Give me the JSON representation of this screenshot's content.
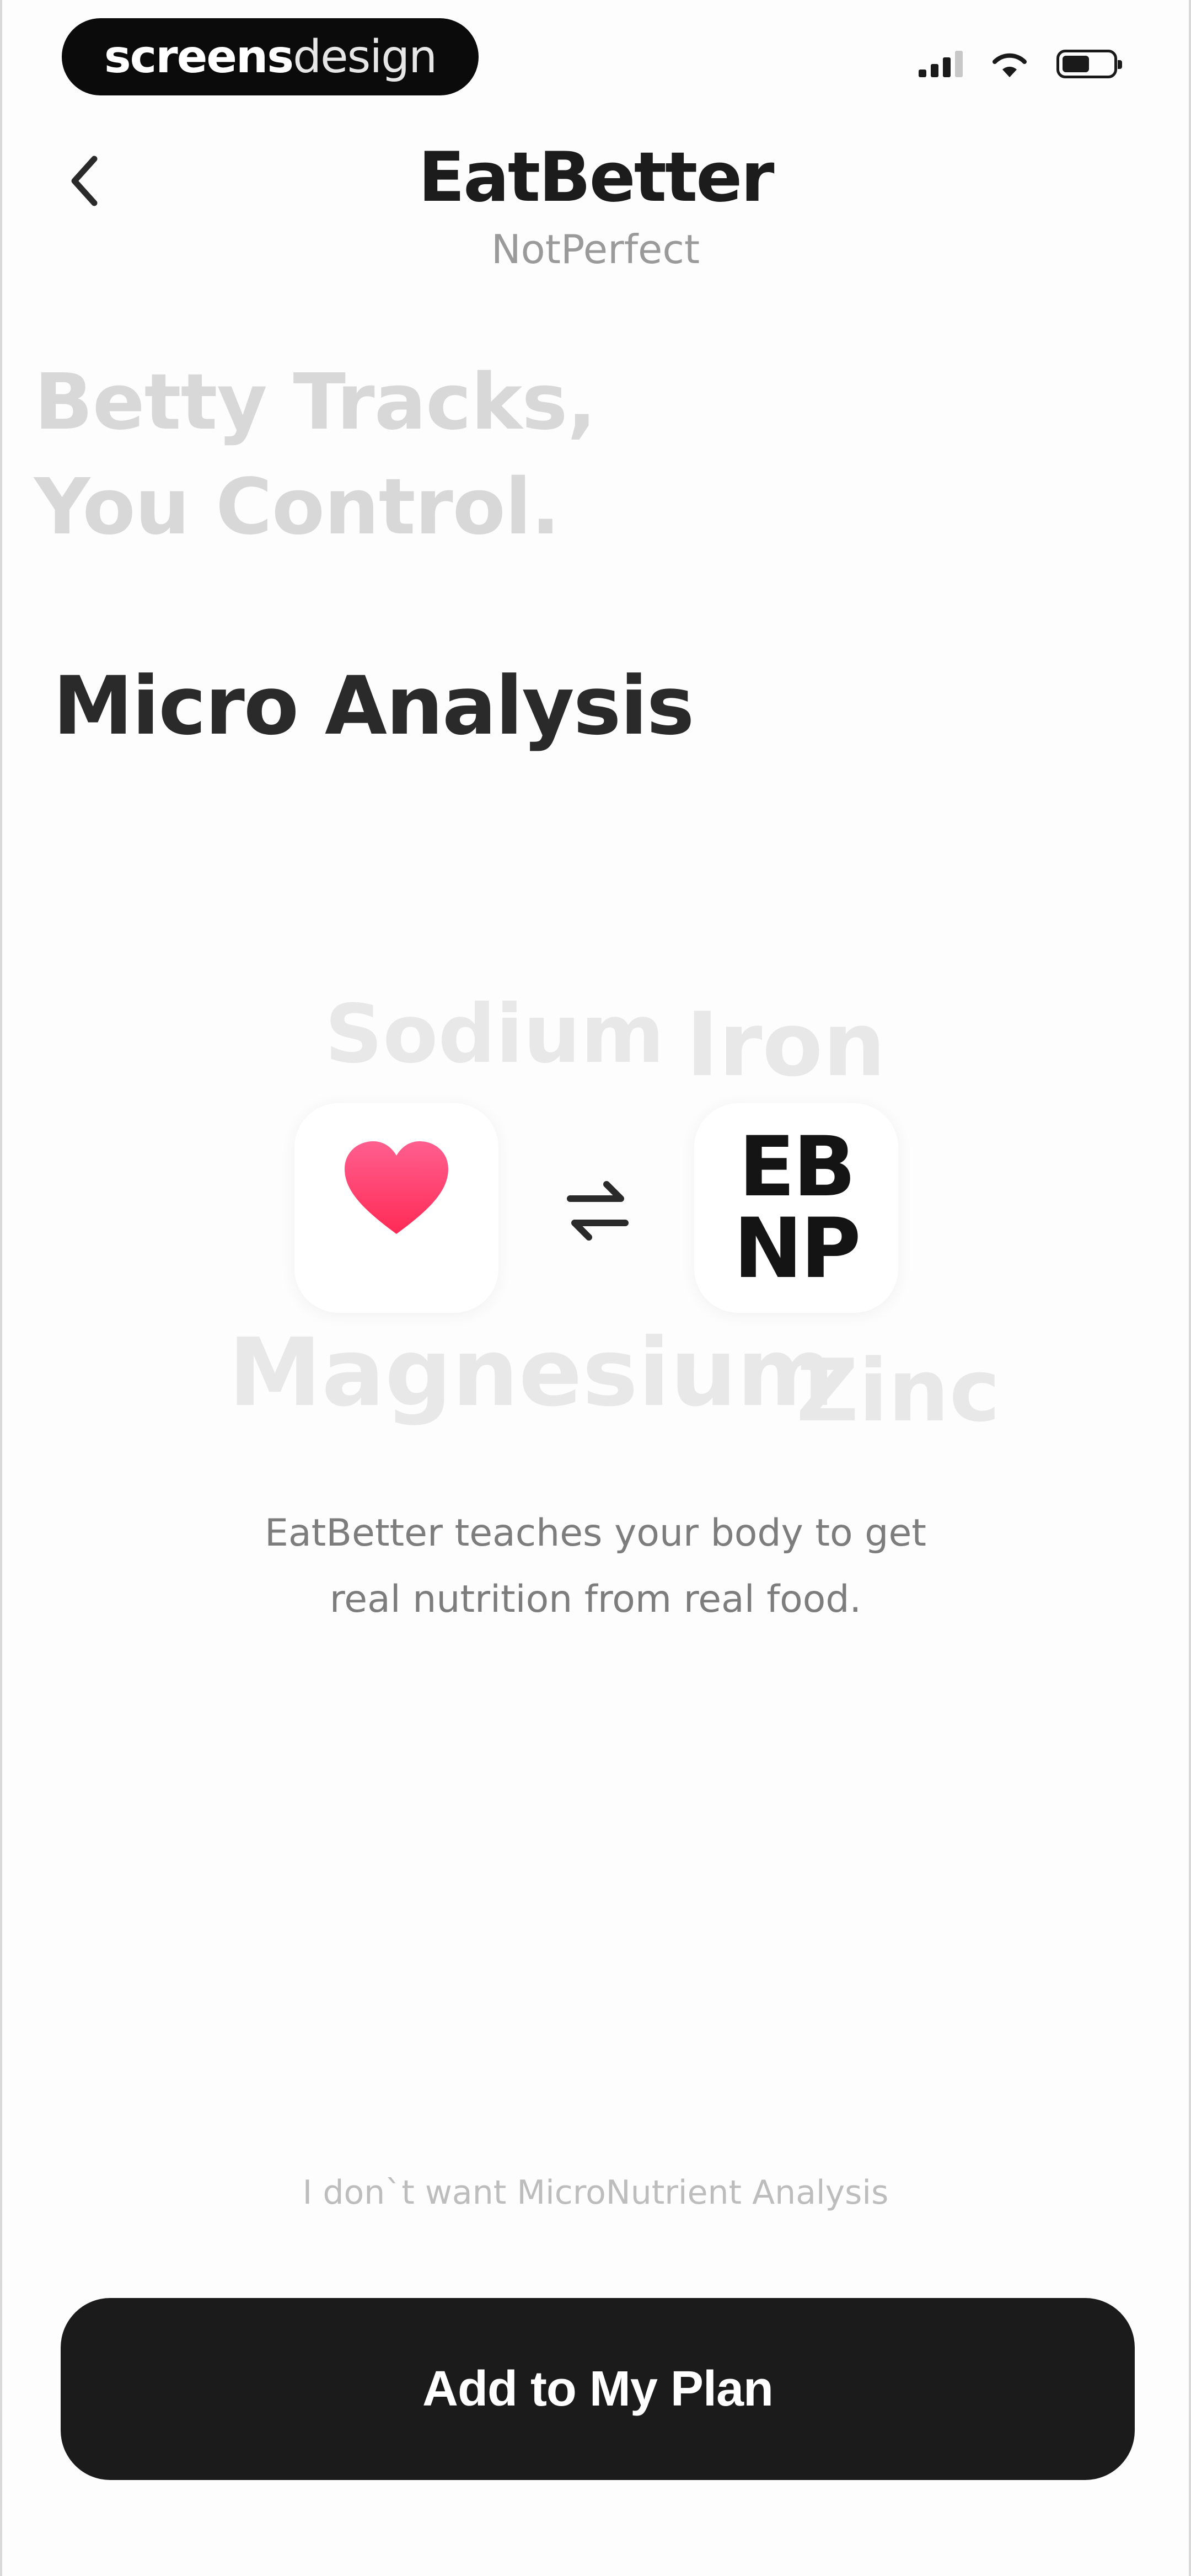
{
  "status_bar": {
    "badge_bold": "screens",
    "badge_light": "design"
  },
  "header": {
    "title": "EatBetter",
    "subtitle": "NotPerfect"
  },
  "tagline": {
    "line1": "Betty Tracks,",
    "line2": "You Control."
  },
  "section": {
    "title": "Micro Analysis"
  },
  "nutrients": [
    "Sodium",
    "Iron",
    "Magnesium",
    "Zinc"
  ],
  "integration": {
    "app_logo_line1": "EB",
    "app_logo_line2": "NP"
  },
  "description": {
    "line1": "EatBetter teaches your body to get",
    "line2": "real nutrition from real food."
  },
  "actions": {
    "skip_label": "I don`t want MicroNutrient Analysis",
    "primary_label": "Add to My Plan"
  },
  "colors": {
    "primary": "#1b1b1b",
    "heart": "#ff2d6f"
  },
  "icons": {
    "back": "chevron-left-icon",
    "health": "heart-icon",
    "swap": "swap-arrows-icon"
  }
}
